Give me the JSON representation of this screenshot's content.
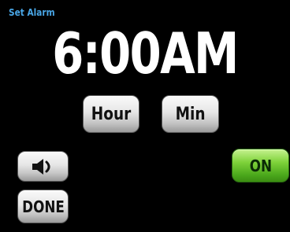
{
  "screen": {
    "title": "Set Alarm",
    "time": "6:00AM"
  },
  "controls": {
    "hour_label": "Hour",
    "min_label": "Min",
    "sound_icon": "speaker-icon",
    "on_label": "ON",
    "done_label": "DONE"
  },
  "colors": {
    "background": "#000000",
    "title": "#49a6e6",
    "time": "#ffffff",
    "on_button": "#4aa71b",
    "button_gray": "#d9d9d9"
  }
}
